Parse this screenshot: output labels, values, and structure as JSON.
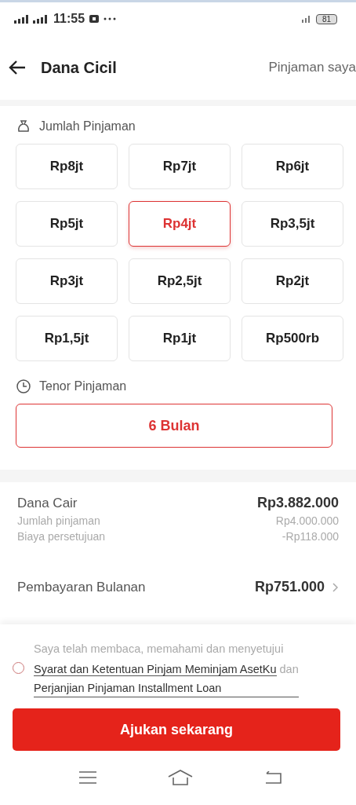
{
  "status_bar": {
    "time": "11:55",
    "battery": "81"
  },
  "header": {
    "title": "Dana Cicil",
    "action": "Pinjaman saya"
  },
  "amount": {
    "label": "Jumlah Pinjaman",
    "options": [
      {
        "label": "Rp8jt",
        "selected": false
      },
      {
        "label": "Rp7jt",
        "selected": false
      },
      {
        "label": "Rp6jt",
        "selected": false
      },
      {
        "label": "Rp5jt",
        "selected": false
      },
      {
        "label": "Rp4jt",
        "selected": true
      },
      {
        "label": "Rp3,5jt",
        "selected": false
      },
      {
        "label": "Rp3jt",
        "selected": false
      },
      {
        "label": "Rp2,5jt",
        "selected": false
      },
      {
        "label": "Rp2jt",
        "selected": false
      },
      {
        "label": "Rp1,5jt",
        "selected": false
      },
      {
        "label": "Rp1jt",
        "selected": false
      },
      {
        "label": "Rp500rb",
        "selected": false
      }
    ]
  },
  "tenor": {
    "label": "Tenor Pinjaman",
    "options": [
      {
        "label": "6 Bulan",
        "selected": true
      }
    ]
  },
  "summary": {
    "title": "Dana Cair",
    "total": "Rp3.882.000",
    "lines": [
      {
        "label": "Jumlah pinjaman",
        "value": "Rp4.000.000"
      },
      {
        "label": "Biaya persetujuan",
        "value": "-Rp118.000"
      }
    ]
  },
  "monthly": {
    "label": "Pembayaran Bulanan",
    "value": "Rp751.000"
  },
  "agreement": {
    "checked": false,
    "intro": "Saya telah membaca, memahami dan menyetujui",
    "link_1": "Syarat dan Ketentuan Pinjam Meminjam AsetKu",
    "joiner": "dan",
    "link_2": "Perjanjian Pinjaman Installment Loan"
  },
  "submit": "Ajukan sekarang"
}
